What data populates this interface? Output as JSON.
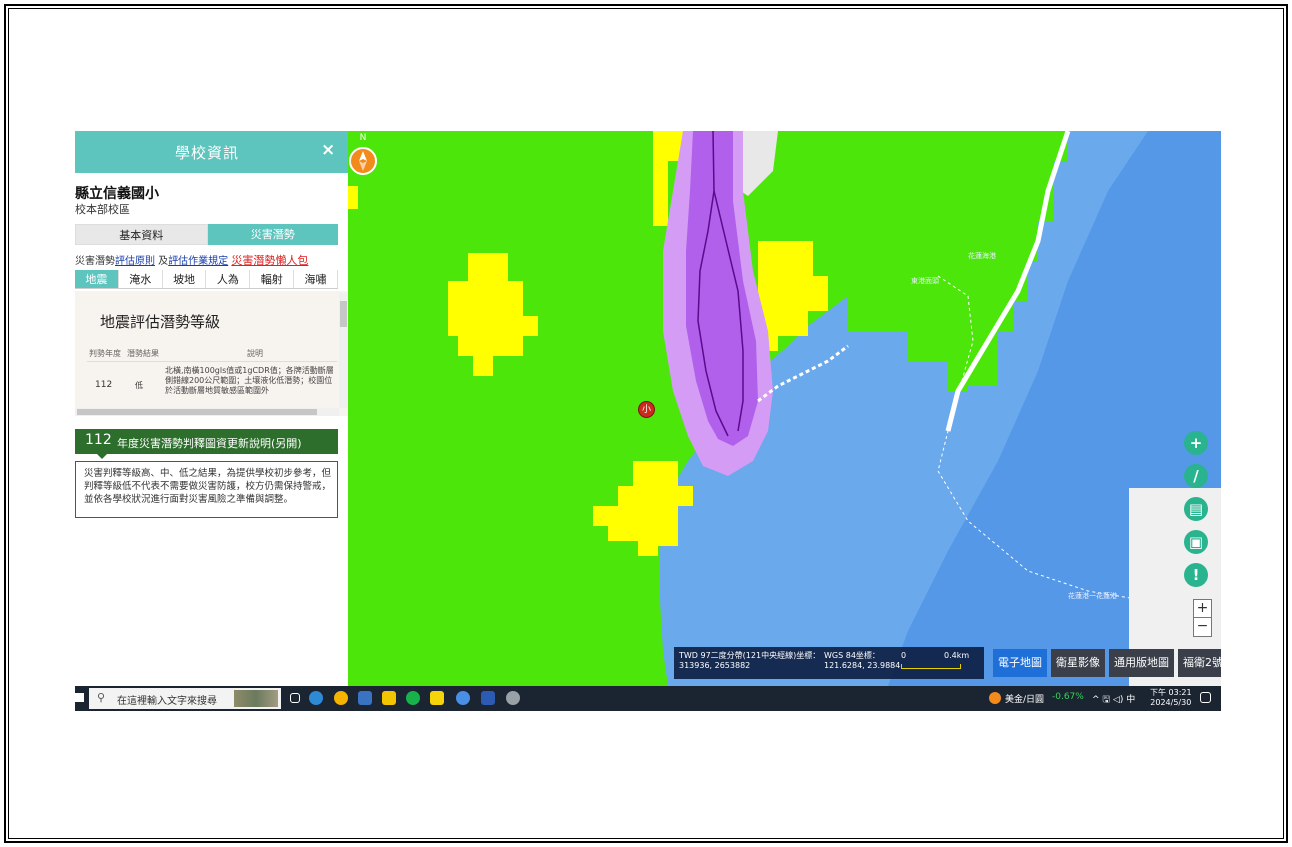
{
  "panel": {
    "title": "學校資訊",
    "close": "×",
    "school_name": "縣立信義國小",
    "campus": "校本部校區",
    "tabs": [
      "基本資料",
      "災害潛勢"
    ],
    "links": {
      "prefix": "災害潛勢",
      "eval_link": "評估原則",
      "and": " 及",
      "ops_link": "評估作業規定",
      "pack_link": "災害潛勢懶人包"
    },
    "hazard_tabs": [
      "地震",
      "淹水",
      "坡地",
      "人為",
      "輻射",
      "海嘯"
    ],
    "hazard_heading": "地震評估潛勢等級",
    "table_headers": [
      "判勢年度",
      "潛勢結果",
      "說明"
    ],
    "row": {
      "year": "112",
      "level": "低",
      "desc": "北橫,南橫100gls值或1gCDR值；各牌活動斷層側錯線200公尺範圍；土壤液化低潛勢；校園位於活動斷層地質敏感區範圍外"
    },
    "update": {
      "year": "112",
      "text": "年度災害潛勢判釋圖資更新說明(另開)"
    },
    "notice": "災害判釋等級高、中、低之結果，為提供學校初步參考，但判釋等級低不代表不需要做災害防護，校方仍需保持警戒，並依各學校狀況進行面對災害風險之準備與調整。"
  },
  "map": {
    "marker": "小",
    "labels": [
      "花蓮海港",
      "東港面頭",
      "花蓮港一花蓮港",
      "花蓮港一花蓮港"
    ],
    "compass": "N",
    "coords": {
      "twd_label": "TWD 97二度分帶(121中央經線)坐標：",
      "twd_value": "313936, 2653882",
      "wgs_label": "WGS 84坐標：",
      "wgs_value": "121.6284, 23.9884",
      "scale_start": "0",
      "scale_end": "0.4km"
    },
    "basemaps": [
      "電子地圖",
      "衛星影像",
      "通用版地圖",
      "福衛2號"
    ],
    "active_basemap": "電子地圖",
    "zoom_in": "+",
    "zoom_out": "−"
  },
  "taskbar": {
    "search_placeholder": "在這裡輸入文字來搜尋",
    "search_icon": "magnifier-icon",
    "stock": "美金/日圓",
    "stock_change": "-0.67%",
    "tray": "^ 🖫 ◁) 中",
    "time": "下午 03:21",
    "date": "2024/5/30"
  },
  "colors": {
    "panel_accent": "#5ec4be",
    "update_bar": "#2d6e2d",
    "land_green": "#4de60a",
    "hazard_yellow": "#ffff00",
    "sea_blue": "#6aa9ec",
    "purple_zone": "#c98bf2",
    "active_button": "#1f6fd8"
  }
}
